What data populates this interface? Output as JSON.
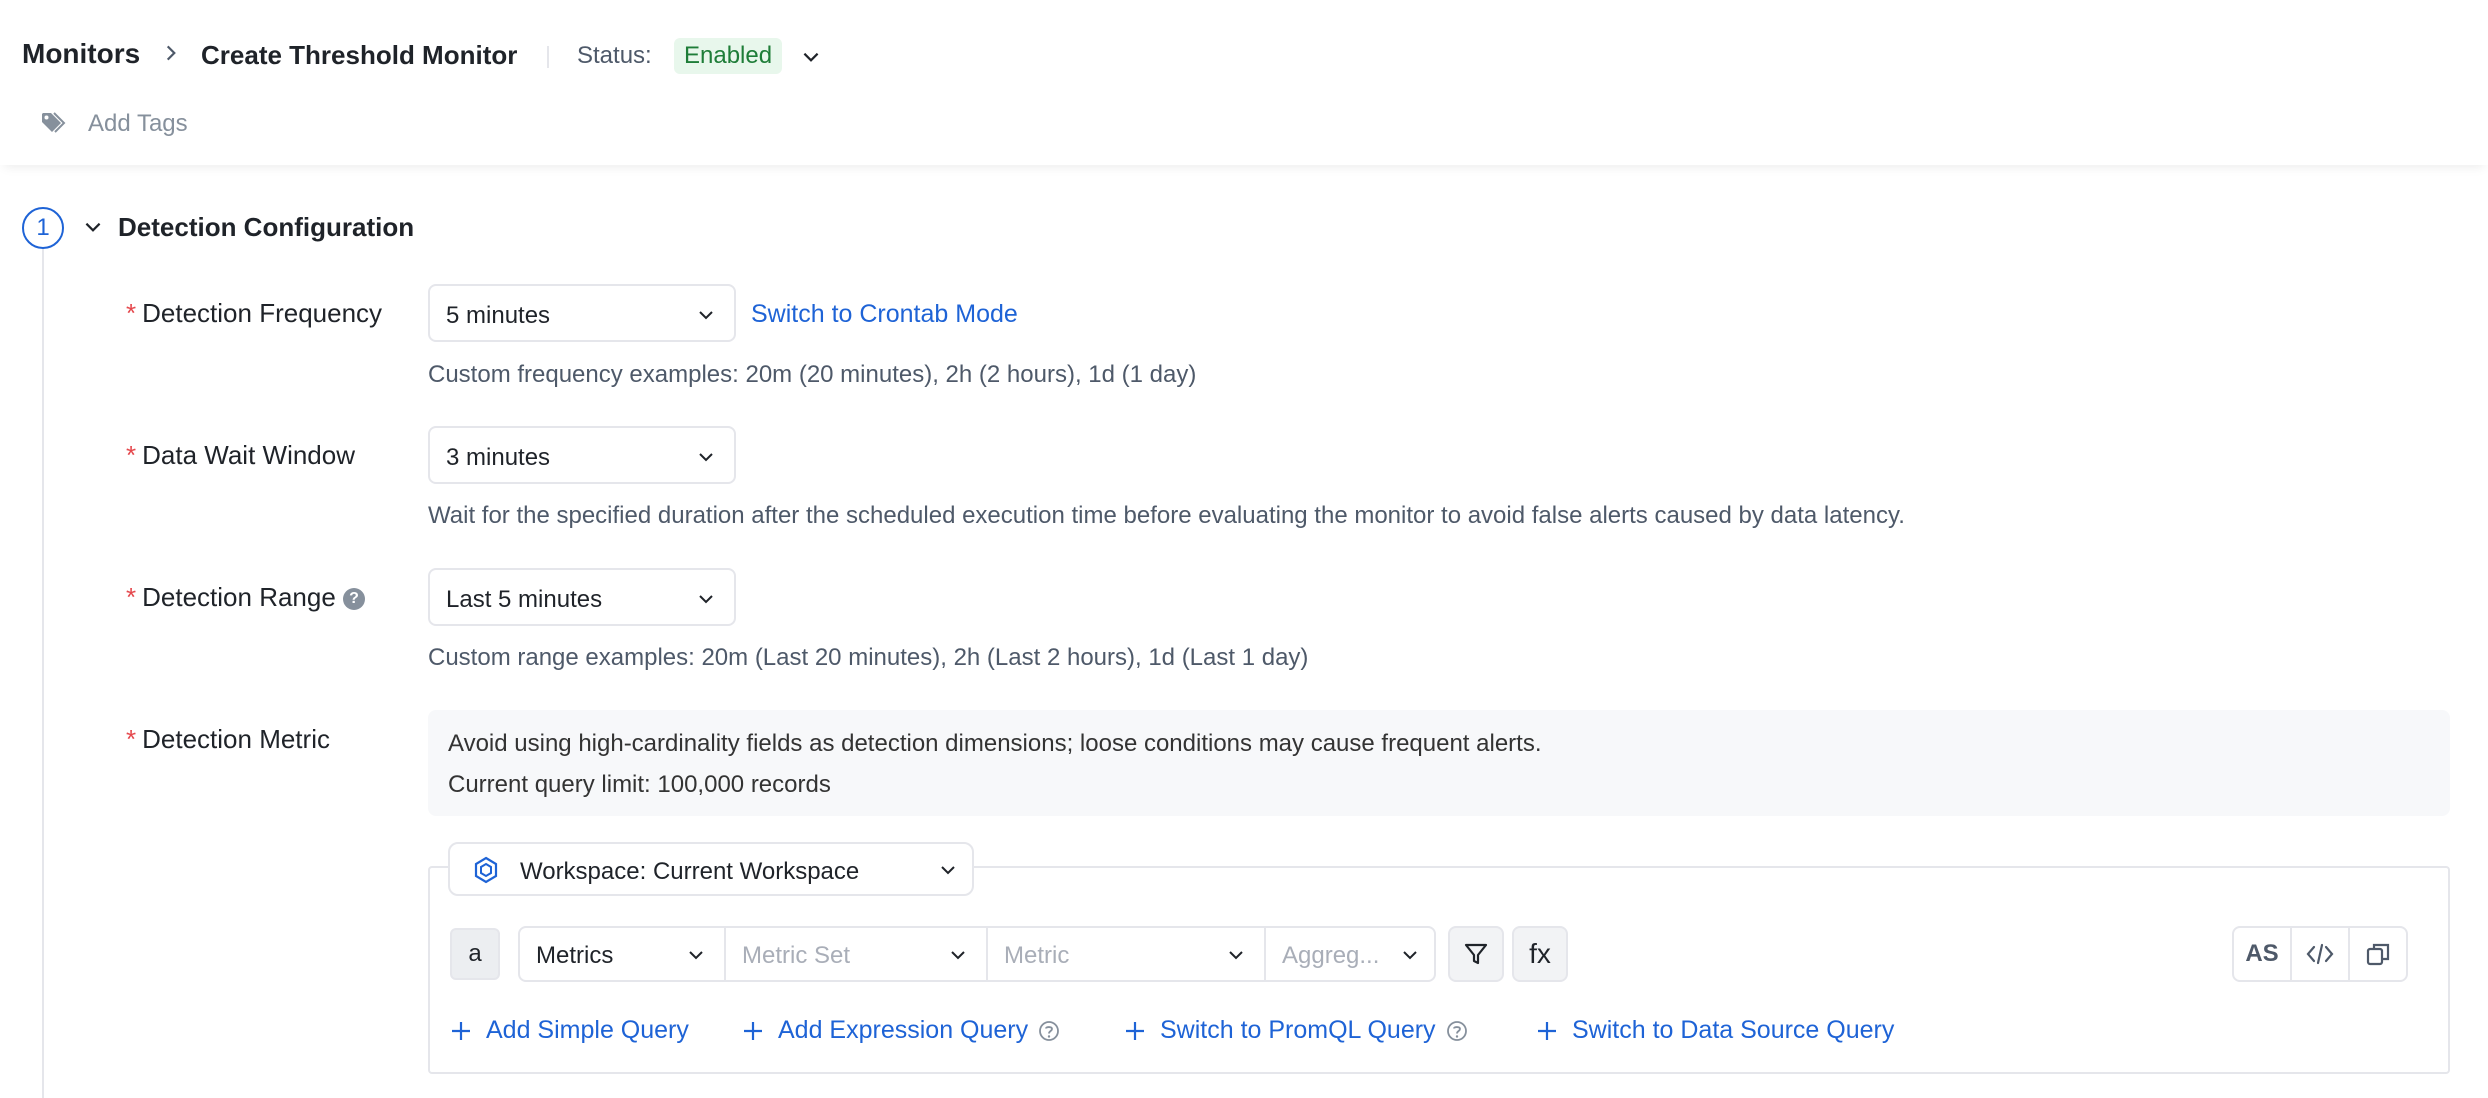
{
  "header": {
    "breadcrumb_root": "Monitors",
    "breadcrumb_current": "Create Threshold Monitor",
    "status_label": "Status:",
    "status_value": "Enabled",
    "add_tags": "Add Tags"
  },
  "section": {
    "step": "1",
    "title": "Detection Configuration"
  },
  "fields": {
    "frequency": {
      "label": "Detection Frequency",
      "value": "5 minutes",
      "link": "Switch to Crontab Mode",
      "help": "Custom frequency examples: 20m (20 minutes), 2h (2 hours), 1d (1 day)"
    },
    "wait_window": {
      "label": "Data Wait Window",
      "value": "3 minutes",
      "help": "Wait for the specified duration after the scheduled execution time before evaluating the monitor to avoid false alerts caused by data latency."
    },
    "range": {
      "label": "Detection Range",
      "value": "Last 5 minutes",
      "help": "Custom range examples: 20m (Last 20 minutes), 2h (Last 2 hours), 1d (Last 1 day)"
    },
    "metric": {
      "label": "Detection Metric",
      "notice_line1": "Avoid using high-cardinality fields as detection dimensions; loose conditions may cause frequent alerts.",
      "notice_line2": "Current query limit: 100,000 records"
    }
  },
  "query": {
    "workspace": "Workspace: Current Workspace",
    "alias": "a",
    "source": "Metrics",
    "metric_set_placeholder": "Metric Set",
    "metric_placeholder": "Metric",
    "aggregation_placeholder": "Aggreg...",
    "fx_label": "fx",
    "as_label": "AS",
    "actions": {
      "simple": "Add Simple Query",
      "expression": "Add Expression Query",
      "promql": "Switch to PromQL Query",
      "datasource": "Switch to Data Source Query"
    }
  },
  "colors": {
    "accent": "#1e63d6",
    "required": "#e5484d",
    "status_bg": "#e8f7ec",
    "status_text": "#1e7d38"
  }
}
